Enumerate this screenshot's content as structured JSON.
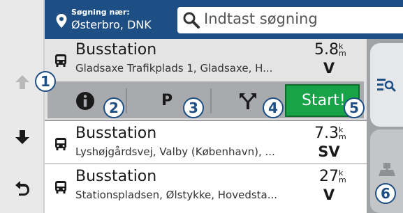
{
  "search_near": {
    "label": "Søgning nær:",
    "value": "Østerbro, DNK"
  },
  "search": {
    "placeholder": "Indtast søgning"
  },
  "results": [
    {
      "name": "Busstation",
      "address": "Gladsaxe Trafikplads 1, Gladsaxe, H...",
      "distance": "5.8",
      "unit_top": "k",
      "unit_bottom": "m",
      "direction": "V",
      "icon": "bus-icon"
    },
    {
      "name": "Busstation",
      "address": "Lyshøjgårdsvej, Valby (København), ...",
      "distance": "7.3",
      "unit_top": "k",
      "unit_bottom": "m",
      "direction": "SV",
      "icon": "bus-icon"
    },
    {
      "name": "Busstation",
      "address": "Stationspladsen, Ølstykke, Hovedsta...",
      "distance": "27",
      "unit_top": "k",
      "unit_bottom": "m",
      "direction": "V",
      "icon": "bus-icon"
    }
  ],
  "actions": {
    "info_icon": "info-icon",
    "parking_label": "P",
    "route_icon": "route-options-icon",
    "start_label": "Start!"
  },
  "nav": {
    "up_icon": "arrow-up-icon",
    "down_icon": "arrow-down-icon",
    "back_icon": "back-icon"
  },
  "side_tabs": {
    "list_icon": "list-search-icon",
    "map_icon": "map-icon"
  },
  "callouts": [
    "1",
    "2",
    "3",
    "4",
    "5",
    "6"
  ],
  "colors": {
    "header": "#1d4f84",
    "start": "#18a348",
    "tab_rail": "#9fa3a5"
  }
}
